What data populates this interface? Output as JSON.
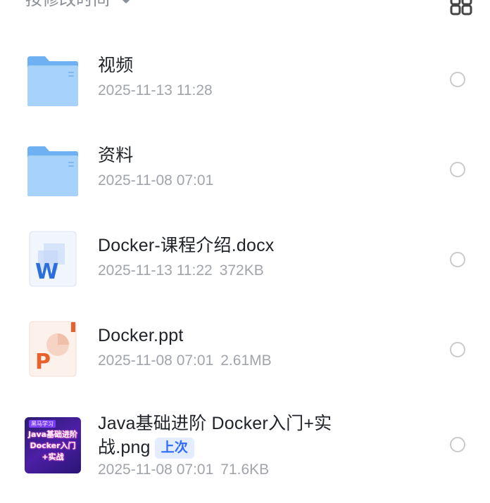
{
  "sort": {
    "label": "按修改时间",
    "arrow_icon": "arrow-down-icon",
    "view_toggle_icon": "grid-view-icon"
  },
  "files": [
    {
      "name": "视频",
      "type": "folder",
      "date": "2025-11-13 11:28",
      "size": ""
    },
    {
      "name": "资料",
      "type": "folder",
      "date": "2025-11-08 07:01",
      "size": ""
    },
    {
      "name": "Docker-课程介绍.docx",
      "type": "word",
      "date": "2025-11-13 11:22",
      "size": "372KB"
    },
    {
      "name": "Docker.ppt",
      "type": "powerpoint",
      "date": "2025-11-08 07:01",
      "size": "2.61MB"
    },
    {
      "name_line1": "Java基础进阶 Docker入门+实",
      "name_line2": "战.png",
      "type": "image",
      "badge": "上次",
      "date": "2025-11-08 07:01",
      "size": "71.6KB",
      "thumbnail": {
        "tag": "黑马学习",
        "line1": "Java基础进阶",
        "line2": "Docker入门",
        "line3": "+实战"
      }
    }
  ],
  "colors": {
    "folder": "#8cc4f8",
    "word": "#2a6fdb",
    "ppt": "#e8602c",
    "badge_bg": "#e4ecff",
    "badge_text": "#2f6bff"
  }
}
